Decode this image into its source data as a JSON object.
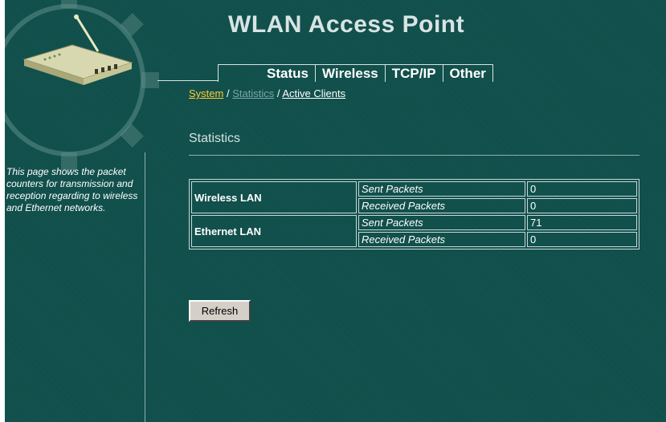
{
  "header": {
    "title": "WLAN Access Point"
  },
  "nav": {
    "tabs": [
      {
        "label": "Status"
      },
      {
        "label": "Wireless"
      },
      {
        "label": "TCP/IP"
      },
      {
        "label": "Other"
      }
    ]
  },
  "subnav": {
    "items": [
      {
        "label": "System",
        "state": "active"
      },
      {
        "label": "Statistics",
        "state": "current"
      },
      {
        "label": "Active Clients",
        "state": "link"
      }
    ],
    "separator": "/"
  },
  "sidebar": {
    "description": "This page shows the packet counters for transmission and reception regarding to wireless and Ethernet networks."
  },
  "main": {
    "section_title": "Statistics",
    "stats": [
      {
        "group": "Wireless LAN",
        "rows": [
          {
            "label": "Sent Packets",
            "value": "0"
          },
          {
            "label": "Received Packets",
            "value": "0"
          }
        ]
      },
      {
        "group": "Ethernet LAN",
        "rows": [
          {
            "label": "Sent Packets",
            "value": "71"
          },
          {
            "label": "Received Packets",
            "value": "0"
          }
        ]
      }
    ],
    "refresh_label": "Refresh"
  },
  "colors": {
    "background": "#0f4e4a",
    "active_link": "#ffcc33",
    "dim_link": "#7aa6a4",
    "text": "#ffffff"
  },
  "icons": {
    "logo": "router-icon",
    "decoration": "gear-decoration"
  }
}
